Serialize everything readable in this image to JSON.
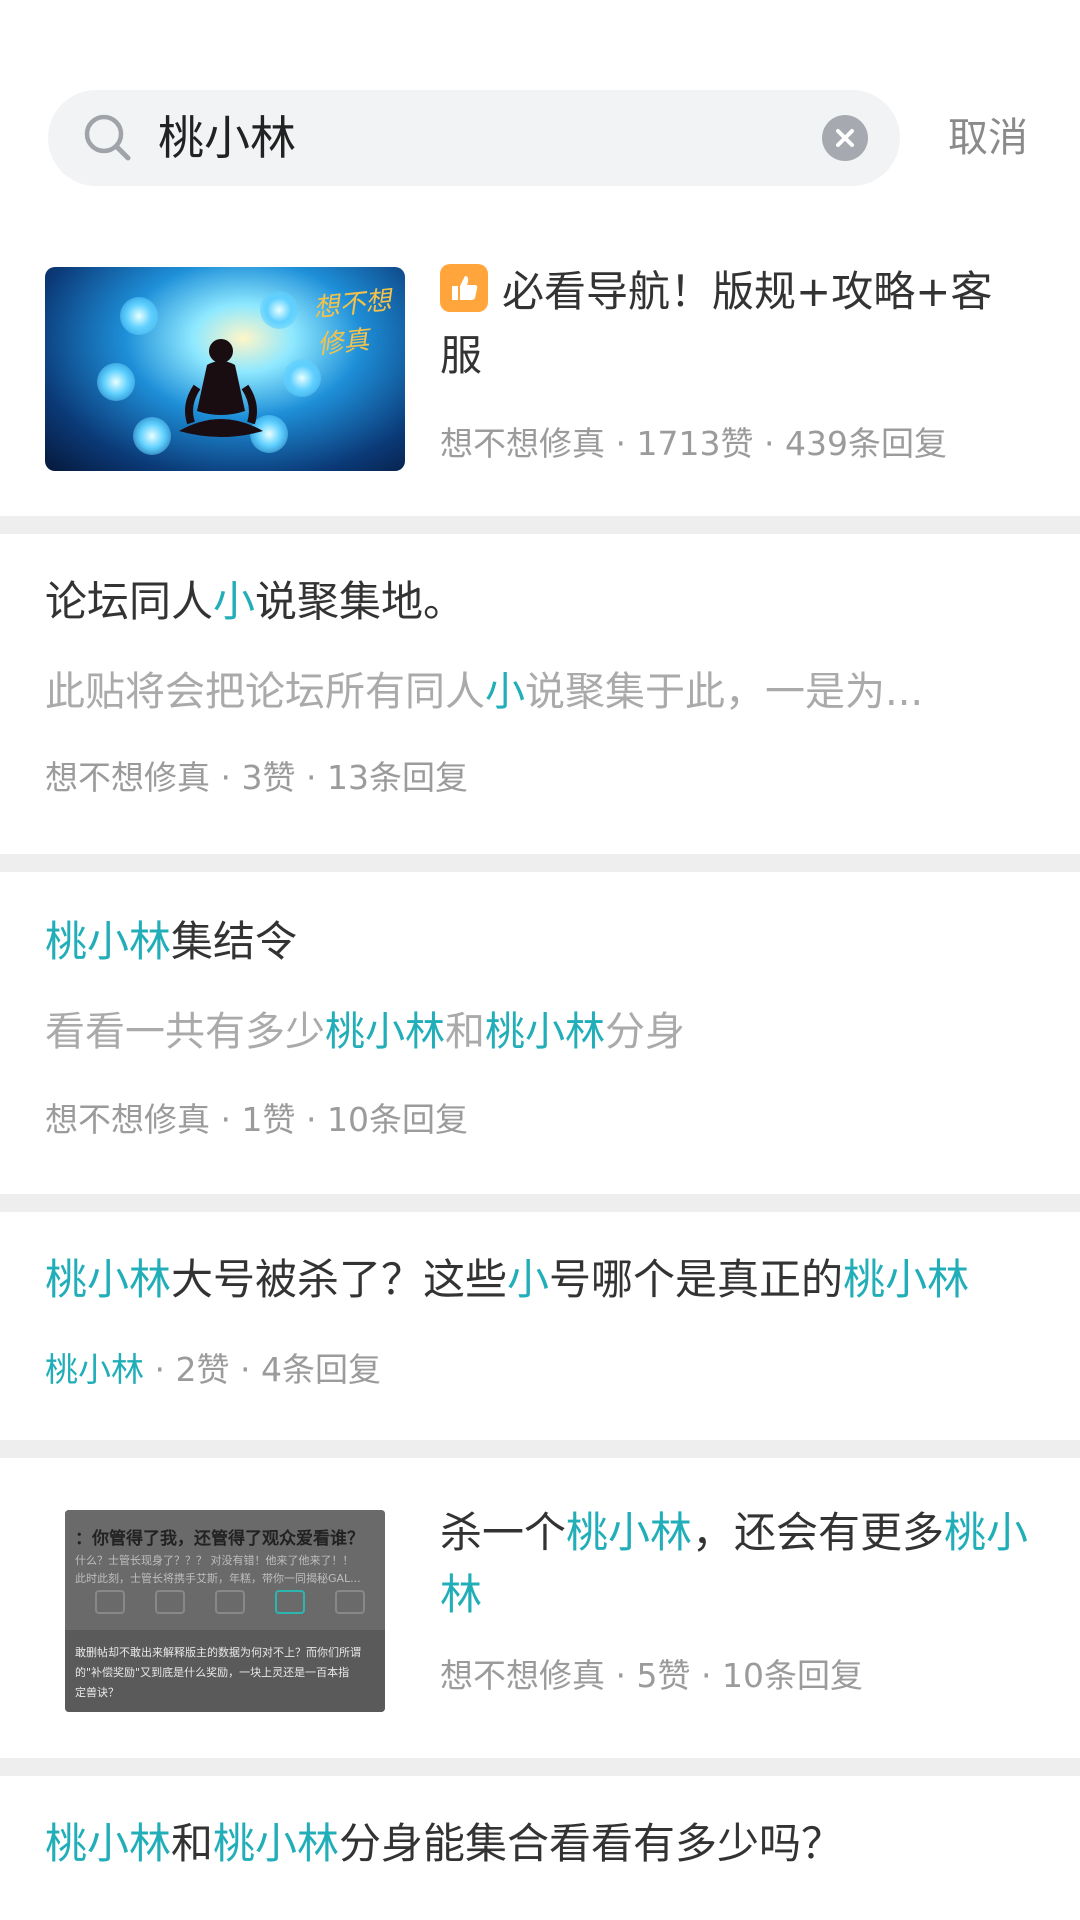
{
  "search": {
    "query": "桃小林",
    "cancel_label": "取消"
  },
  "posts": [
    {
      "title_parts": [
        "必看导航！版规+攻略+客服"
      ],
      "badge": "like-icon",
      "game_logo_text": "想不想修真",
      "author": "想不想修真",
      "likes": "1713赞",
      "replies": "439条回复"
    },
    {
      "title_parts": [
        "论坛同人",
        "小",
        "说聚集地。"
      ],
      "summary_parts": [
        "此贴将会把论坛所有同人",
        "小",
        "说聚集于此，一是为..."
      ],
      "author": "想不想修真",
      "likes": "3赞",
      "replies": "13条回复"
    },
    {
      "title_parts": [
        "桃小林",
        "集结令"
      ],
      "summary_parts": [
        "看看一共有多少",
        "桃小林",
        "和",
        "桃小林",
        "分身"
      ],
      "author": "想不想修真",
      "likes": "1赞",
      "replies": "10条回复"
    },
    {
      "title_parts": [
        "桃小林",
        "大号被杀了？这些",
        "小",
        "号哪个是真正的",
        "桃小林"
      ],
      "author": "桃小林",
      "likes": "2赞",
      "replies": "4条回复"
    },
    {
      "title_parts": [
        "杀一个",
        "桃小林",
        "，还会有更多",
        "桃小林"
      ],
      "thumb": {
        "question": "：你管得了我，还管得了观众爱看谁？",
        "line1": "什么？士管长现身了？？？ 对没有错！他来了他来了！！",
        "line2": "此时此刻，士管长将携手艾斯，年糕，带你一同揭秘GAL...",
        "body1": "敢删帖却不敢出来解释版主的数据为何对不上？而你们所谓",
        "body2": "的\"补偿奖励\"又到底是什么奖励，一块上灵还是一百本指",
        "body3": "定兽诀？"
      },
      "author": "想不想修真",
      "likes": "5赞",
      "replies": "10条回复"
    },
    {
      "title_parts": [
        "桃小林",
        "和",
        "桃小林",
        "分身能集合看看有多少吗？"
      ]
    }
  ],
  "colors": {
    "highlight": "#22aeb8",
    "badge": "#ffa53b",
    "meta": "#9b9b9b",
    "separator": "#eeeeee"
  },
  "meta_separator": " · "
}
